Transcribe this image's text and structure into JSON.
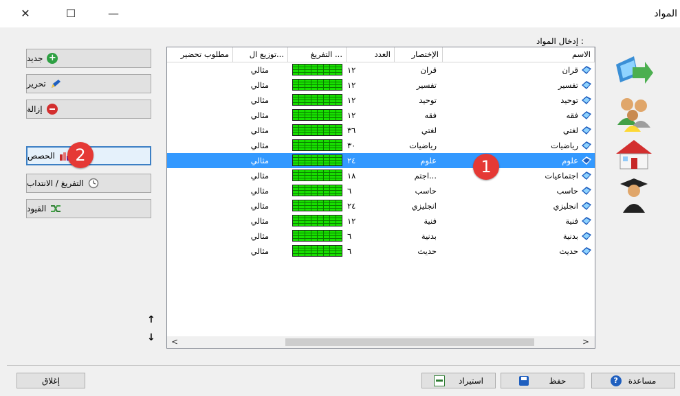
{
  "window": {
    "title": "المواد"
  },
  "titlebar": {
    "close": "✕",
    "maximize": "☐",
    "minimize": "—"
  },
  "left_buttons": [
    {
      "name": "new-button",
      "label": "جديد",
      "icon": "plus-circle-icon",
      "color": "#2ea043"
    },
    {
      "name": "edit-button",
      "label": "تحرير",
      "icon": "pencil-icon",
      "color": "#1f5fbf"
    },
    {
      "name": "delete-button",
      "label": "إزالة",
      "icon": "minus-circle-icon",
      "color": "#d32f2f"
    },
    {
      "name": "shares-button",
      "label": "الحصص",
      "icon": "chart-icon",
      "color": "#c62828"
    },
    {
      "name": "allocation-button",
      "label": "التفريغ / الانتداب",
      "icon": "clock-icon",
      "color": "#777777"
    },
    {
      "name": "constraints-button",
      "label": "القيود",
      "icon": "shuffle-icon",
      "color": "#2e7d32"
    }
  ],
  "entry_label": "إدخال المواد :",
  "grid": {
    "headers": [
      "الاسم",
      "الإختصار",
      "العدد",
      "التفريغ ...",
      "توزيع ال...",
      "مطلوب تحضير"
    ],
    "selected_index": 6,
    "rows": [
      {
        "name": "قران",
        "abbr": "قران",
        "count": "١٢",
        "dist": "مثالي"
      },
      {
        "name": "تفسير",
        "abbr": "تفسير",
        "count": "١٢",
        "dist": "مثالي"
      },
      {
        "name": "توحيد",
        "abbr": "توحيد",
        "count": "١٢",
        "dist": "مثالي"
      },
      {
        "name": "فقه",
        "abbr": "فقه",
        "count": "١٢",
        "dist": "مثالي"
      },
      {
        "name": "لغتي",
        "abbr": "لغتي",
        "count": "٣٦",
        "dist": "مثالي"
      },
      {
        "name": "رياضيات",
        "abbr": "رياضيات",
        "count": "٣٠",
        "dist": "مثالي"
      },
      {
        "name": "علوم",
        "abbr": "علوم",
        "count": "٢٤",
        "dist": "مثالي"
      },
      {
        "name": "اجتماعيات",
        "abbr": "اجتم...",
        "count": "١٨",
        "dist": "مثالي"
      },
      {
        "name": "حاسب",
        "abbr": "حاسب",
        "count": "٦",
        "dist": "مثالي"
      },
      {
        "name": "انجليزي",
        "abbr": "انجليزي",
        "count": "٢٤",
        "dist": "مثالي"
      },
      {
        "name": "فنية",
        "abbr": "فنية",
        "count": "١٢",
        "dist": "مثالي"
      },
      {
        "name": "بدنية",
        "abbr": "بدنية",
        "count": "٦",
        "dist": "مثالي"
      },
      {
        "name": "حديث",
        "abbr": "حديث",
        "count": "٦",
        "dist": "مثالي"
      }
    ]
  },
  "scroll": {
    "left": "<",
    "right": ">",
    "up": "↑",
    "down": "↓"
  },
  "bottom": {
    "help": "مساعدة",
    "save": "حفظ",
    "import": "استيراد",
    "close": "إغلاق"
  },
  "badges": {
    "one": "1",
    "two": "2"
  }
}
